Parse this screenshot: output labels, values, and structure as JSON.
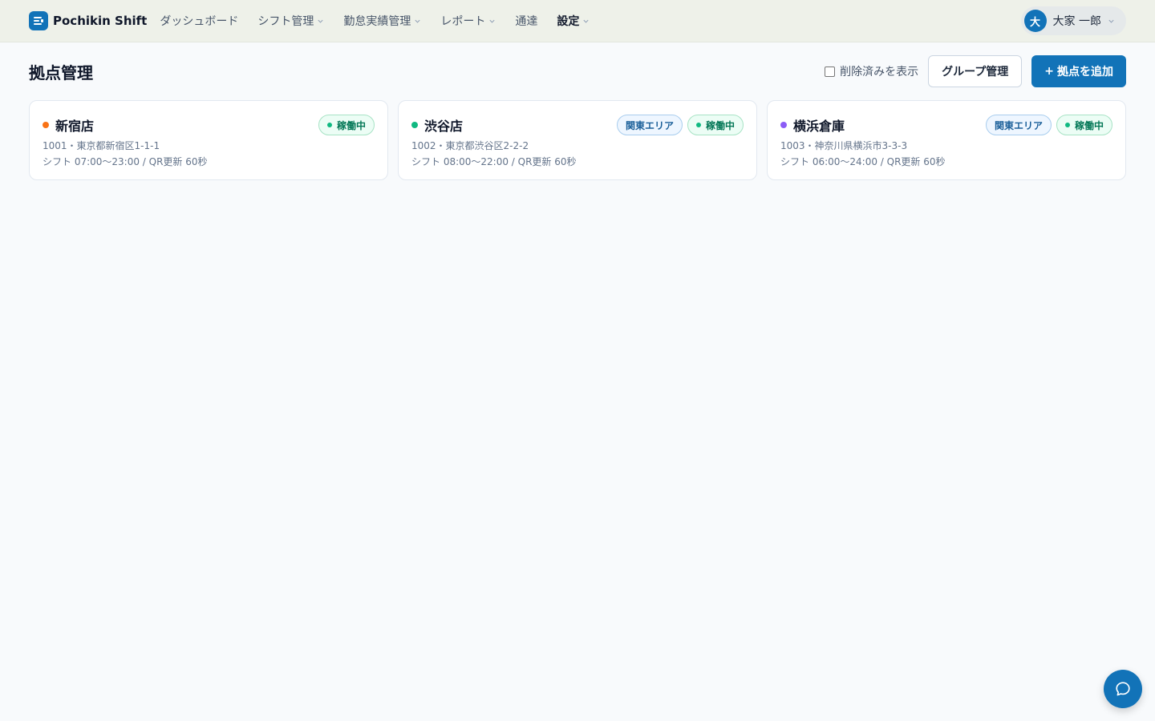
{
  "app": {
    "brand": "Pochikin Shift"
  },
  "nav": [
    {
      "label": "ダッシュボード",
      "has_menu": false,
      "active": false
    },
    {
      "label": "シフト管理",
      "has_menu": true,
      "active": false
    },
    {
      "label": "勤怠実績管理",
      "has_menu": true,
      "active": false
    },
    {
      "label": "レポート",
      "has_menu": true,
      "active": false
    },
    {
      "label": "通達",
      "has_menu": false,
      "active": false
    },
    {
      "label": "設定",
      "has_menu": true,
      "active": true
    }
  ],
  "user": {
    "initial": "大",
    "name": "大家 一郎"
  },
  "page": {
    "title": "拠点管理",
    "show_deleted_label": "削除済みを表示",
    "show_deleted_checked": false,
    "group_button": "グループ管理",
    "add_button": "拠点を追加",
    "add_button_icon": "+"
  },
  "locations": [
    {
      "name": "新宿店",
      "dot_color": "#f97316",
      "area": "",
      "status": "稼働中",
      "address_line": "1001・東京都新宿区1-1-1",
      "shift_line": "シフト 07:00〜23:00 / QR更新 60秒"
    },
    {
      "name": "渋谷店",
      "dot_color": "#10b981",
      "area": "関東エリア",
      "status": "稼働中",
      "address_line": "1002・東京都渋谷区2-2-2",
      "shift_line": "シフト 08:00〜22:00 / QR更新 60秒"
    },
    {
      "name": "横浜倉庫",
      "dot_color": "#8b5cf6",
      "area": "関東エリア",
      "status": "稼働中",
      "address_line": "1003・神奈川県横浜市3-3-3",
      "shift_line": "シフト 06:00〜24:00 / QR更新 60秒"
    }
  ],
  "colors": {
    "primary": "#1273b8",
    "header_bg": "#eef1e9",
    "page_bg": "#f8fafc"
  },
  "icons": {
    "brand": "shift-logo-icon",
    "chevron": "chevron-down-icon",
    "chat": "chat-bubble-icon"
  }
}
